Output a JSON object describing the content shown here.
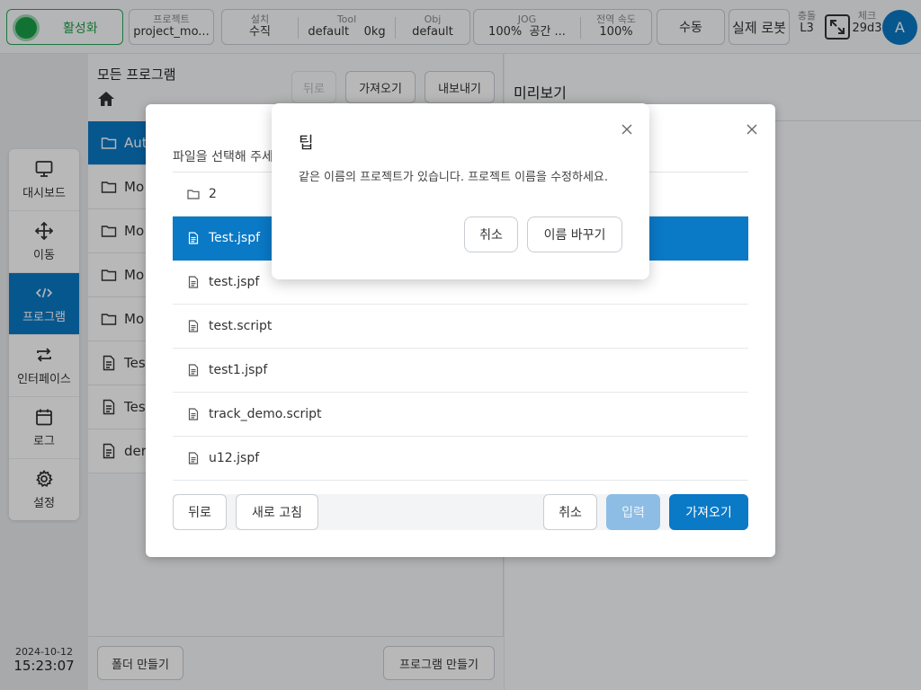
{
  "topbar": {
    "activate_label": "활성화",
    "project": {
      "label": "프로젝트",
      "value": "project_mo..."
    },
    "install": {
      "label": "설치",
      "value": "수직"
    },
    "tool": {
      "label": "Tool",
      "value": "default",
      "weight": "0kg"
    },
    "obj": {
      "label": "Obj",
      "value": "default"
    },
    "jog": {
      "label": "JOG",
      "value": "100%",
      "mode": "공간 ..."
    },
    "global_speed": {
      "label": "전역 속도",
      "value": "100%"
    },
    "mode_button": "수동",
    "robot_button": "실제 로봇",
    "collision": {
      "label": "충돌",
      "value": "L3"
    },
    "check": {
      "label": "체크",
      "value": "29d3"
    },
    "avatar_initial": "A",
    "colors": {
      "active_green": "#1a9e49",
      "accent": "#0a79c6"
    }
  },
  "leftnav": {
    "items": [
      {
        "label": "대시보드",
        "icon": "monitor-icon"
      },
      {
        "label": "이동",
        "icon": "move-arrows-icon"
      },
      {
        "label": "프로그램",
        "icon": "code-icon"
      },
      {
        "label": "인터페이스",
        "icon": "swap-icon"
      },
      {
        "label": "로그",
        "icon": "calendar-icon"
      },
      {
        "label": "설정",
        "icon": "gear-icon"
      }
    ],
    "active_index": 2,
    "date": "2024-10-12",
    "time": "15:23:07"
  },
  "program_panel": {
    "title": "모든 프로그램",
    "back_label": "뒤로",
    "import_label": "가져오기",
    "export_label": "내보내기",
    "rows": [
      {
        "name": "Aut",
        "type": "folder"
      },
      {
        "name": "Mo",
        "type": "folder"
      },
      {
        "name": "Mo",
        "type": "folder"
      },
      {
        "name": "Mo",
        "type": "folder"
      },
      {
        "name": "Mo",
        "type": "folder"
      },
      {
        "name": "Tes",
        "type": "file"
      },
      {
        "name": "Tes",
        "type": "file"
      },
      {
        "name": "der",
        "type": "file"
      }
    ],
    "create_folder_label": "폴더 만들기",
    "create_program_label": "프로그램 만들기"
  },
  "preview": {
    "title": "미리보기"
  },
  "file_dialog": {
    "title": "파일을 선택해 주세",
    "rows": [
      {
        "name": "2",
        "type": "folder"
      },
      {
        "name": "Test.jspf",
        "type": "file",
        "selected": true
      },
      {
        "name": "test.jspf",
        "type": "file"
      },
      {
        "name": "test.script",
        "type": "file"
      },
      {
        "name": "test1.jspf",
        "type": "file"
      },
      {
        "name": "track_demo.script",
        "type": "file"
      },
      {
        "name": "u12.jspf",
        "type": "file"
      }
    ],
    "back_label": "뒤로",
    "refresh_label": "새로 고침",
    "cancel_label": "취소",
    "enter_label": "입력",
    "import_label": "가져오기"
  },
  "tip_modal": {
    "title": "팁",
    "message": "같은 이름의 프로젝트가 있습니다. 프로젝트 이름을 수정하세요.",
    "cancel_label": "취소",
    "rename_label": "이름 바꾸기"
  }
}
